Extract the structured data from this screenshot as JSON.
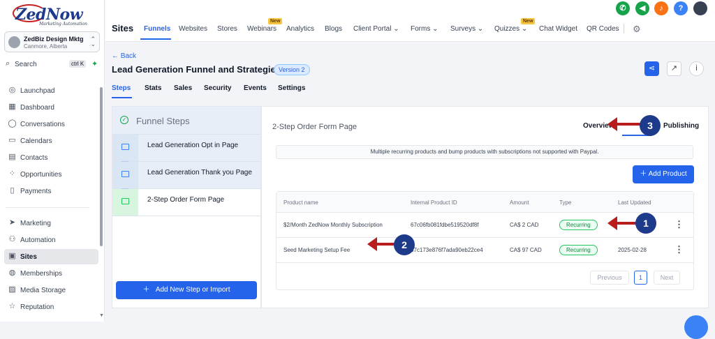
{
  "brand": {
    "logo_main": "ZedNow",
    "logo_sub": "Marketing Automation"
  },
  "account": {
    "name": "ZedBiz Design Mktg",
    "location": "Canmore, Alberta"
  },
  "search": {
    "label": "Search",
    "shortcut": "ctrl K"
  },
  "sidebar": {
    "items": [
      {
        "label": "Launchpad",
        "icon": "rocket-icon"
      },
      {
        "label": "Dashboard",
        "icon": "grid-icon"
      },
      {
        "label": "Conversations",
        "icon": "chat-icon"
      },
      {
        "label": "Calendars",
        "icon": "calendar-icon"
      },
      {
        "label": "Contacts",
        "icon": "contacts-icon"
      },
      {
        "label": "Opportunities",
        "icon": "funnel-icon"
      },
      {
        "label": "Payments",
        "icon": "payments-icon"
      },
      {
        "label": "Marketing",
        "icon": "send-icon"
      },
      {
        "label": "Automation",
        "icon": "automation-icon"
      },
      {
        "label": "Sites",
        "icon": "sites-icon",
        "active": true
      },
      {
        "label": "Memberships",
        "icon": "memberships-icon"
      },
      {
        "label": "Media Storage",
        "icon": "media-icon"
      },
      {
        "label": "Reputation",
        "icon": "star-icon"
      }
    ]
  },
  "topbar": {
    "title": "Sites",
    "nav": [
      "Funnels",
      "Websites",
      "Stores",
      "Webinars",
      "Analytics",
      "Blogs",
      "Client Portal",
      "Forms",
      "Surveys",
      "Quizzes",
      "Chat Widget",
      "QR Codes"
    ],
    "new_badge": "New",
    "header_icons": [
      {
        "name": "phone-icon",
        "color": "#16a34a"
      },
      {
        "name": "megaphone-icon",
        "color": "#16a34a"
      },
      {
        "name": "bell-icon",
        "color": "#f97316"
      },
      {
        "name": "help-icon",
        "color": "#3b82f6"
      }
    ],
    "help_label": "?"
  },
  "page": {
    "back": "Back",
    "title": "Lead Generation Funnel and Strategies",
    "version": "Version 2",
    "tabs": [
      "Steps",
      "Stats",
      "Sales",
      "Security",
      "Events",
      "Settings"
    ]
  },
  "steps_panel": {
    "heading": "Funnel Steps",
    "steps": [
      "Lead Generation Opt in Page",
      "Lead Generation Thank you Page",
      "2-Step Order Form Page"
    ],
    "add_button": "Add New Step or Import"
  },
  "detail": {
    "page_title": "2-Step Order Form Page",
    "tabs": [
      "Overview",
      "Publishing"
    ],
    "notice": "Multiple recurring products and bump products with subscriptions not supported with Paypal.",
    "add_product": "Add Product",
    "columns": [
      "Product name",
      "Internal Product ID",
      "Amount",
      "Type",
      "Last Updated"
    ],
    "rows": [
      {
        "name": "$2/Month ZedNow Monthly Subscription",
        "id": "67c06fb081fdbe519520df8f",
        "amount": "CA$ 2 CAD",
        "type": "Recurring",
        "updated": ""
      },
      {
        "name": "Seed Marketing Setup Fee",
        "id": "67c173e876f7ada90eb22ce4",
        "amount": "CA$ 97 CAD",
        "type": "Recurring",
        "updated": "2025-02-28"
      }
    ],
    "pager": {
      "previous": "Previous",
      "page": "1",
      "next": "Next"
    }
  },
  "callouts": [
    "1",
    "2",
    "3"
  ],
  "colors": {
    "accent": "#2563eb",
    "callout": "#1e3a8a",
    "arrow": "#b91c1c",
    "recurring": "#22c55e"
  }
}
